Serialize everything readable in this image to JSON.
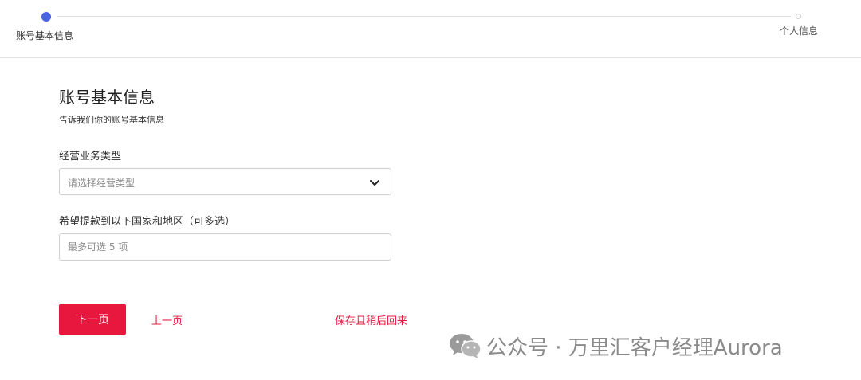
{
  "stepper": {
    "steps": [
      {
        "label": "账号基本信息",
        "active": true
      },
      {
        "label": "个人信息",
        "active": false
      }
    ],
    "active_color": "#4a63e0"
  },
  "form": {
    "title": "账号基本信息",
    "subtitle": "告诉我们你的账号基本信息",
    "business_type": {
      "label": "经营业务类型",
      "placeholder": "请选择经营类型",
      "icon": "chevron-down-icon"
    },
    "withdraw_regions": {
      "label": "希望提款到以下国家和地区（可多选）",
      "placeholder": "最多可选 5 项",
      "value": ""
    }
  },
  "actions": {
    "next_label": "下一页",
    "prev_label": "上一页",
    "save_label": "保存且稍后回来",
    "accent_color": "#e8173d"
  },
  "watermark": {
    "icon": "wechat-icon",
    "text": "公众号 · 万里汇客户经理Aurora"
  }
}
